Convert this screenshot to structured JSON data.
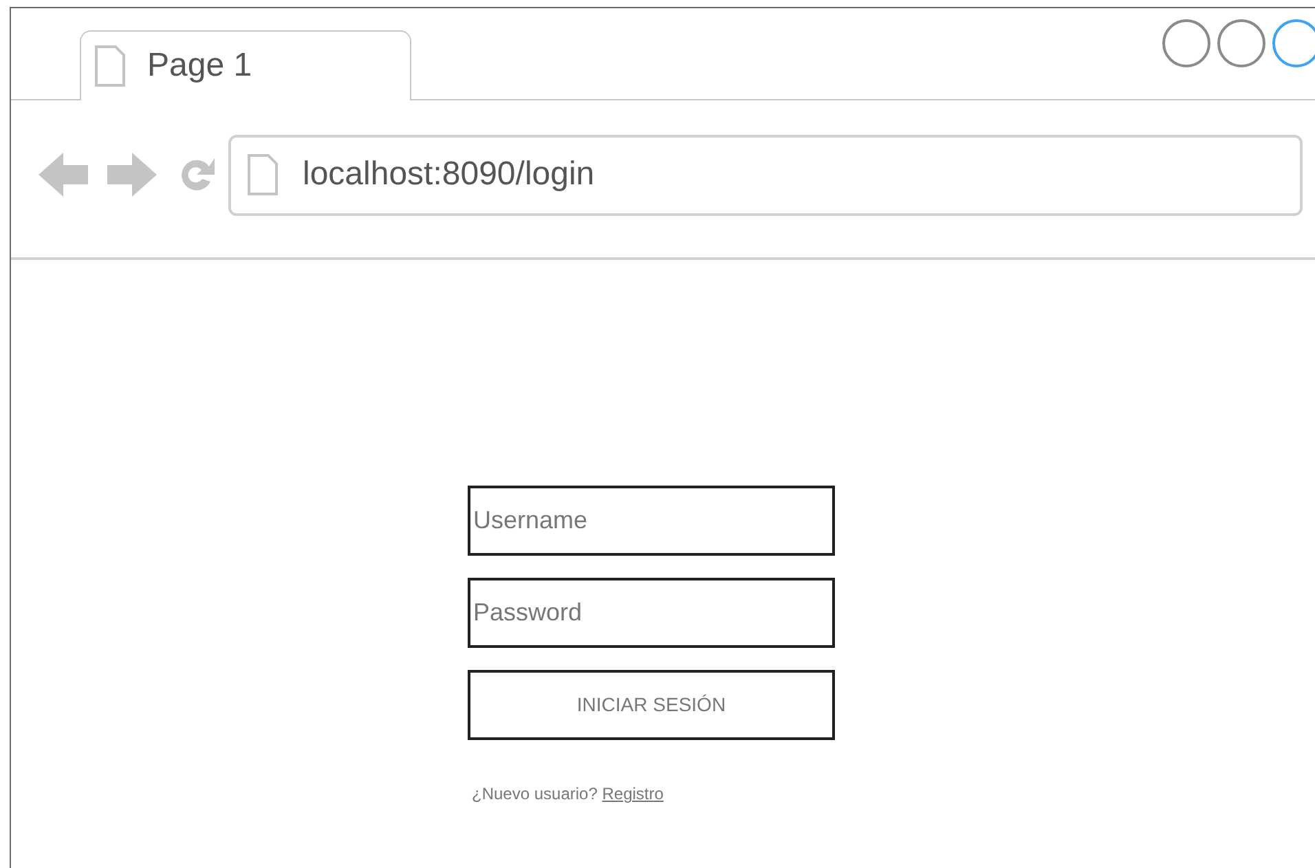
{
  "tabs": [
    {
      "label": "Page 1",
      "selected": true
    }
  ],
  "address_bar": {
    "value": "localhost:8090/login"
  },
  "login_form": {
    "username": {
      "placeholder": "Username"
    },
    "password": {
      "placeholder": "Password"
    },
    "submit": {
      "label": "INICIAR SESIÓN"
    },
    "register_prompt": {
      "text": "¿Nuevo usuario?",
      "link": "Registro"
    }
  }
}
